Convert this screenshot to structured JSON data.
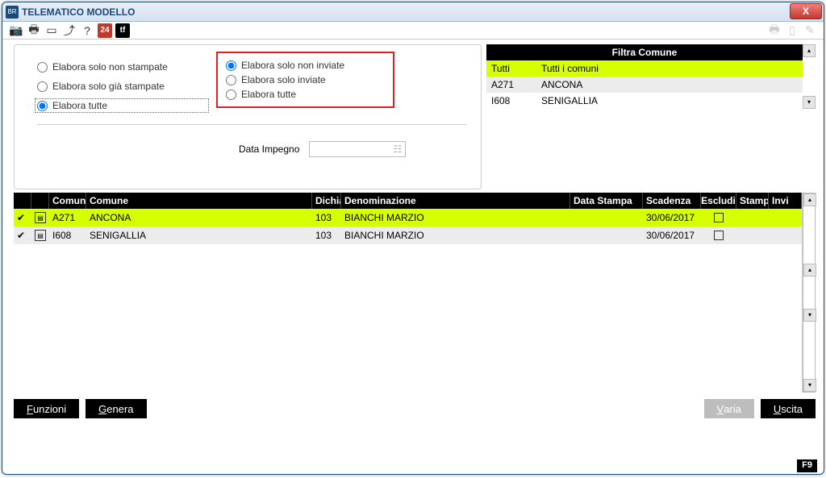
{
  "window": {
    "title": "TELEMATICO MODELLO",
    "icon_text": "BR"
  },
  "toolbar": {
    "camera": "camera-icon",
    "print": "print-icon",
    "open": "open-icon",
    "upload": "upload-icon",
    "help": "?",
    "red24": "24",
    "black": "tf"
  },
  "options": {
    "stampate": {
      "non_stampate": "Elabora solo non stampate",
      "gia_stampate": "Elabora solo già stampate",
      "tutte": "Elabora tutte"
    },
    "inviate": {
      "non_inviate": "Elabora solo non inviate",
      "solo_inviate": "Elabora solo inviate",
      "tutte": "Elabora tutte"
    },
    "data_impegno_label": "Data Impegno",
    "data_impegno_value": ""
  },
  "filtro": {
    "header": "Filtra Comune",
    "rows": [
      {
        "code": "Tutti",
        "name": "Tutti i comuni",
        "selected": true
      },
      {
        "code": "A271",
        "name": "ANCONA",
        "selected": false
      },
      {
        "code": "I608",
        "name": "SENIGALLIA",
        "selected": false
      }
    ]
  },
  "grid": {
    "headers": {
      "c3": "Comun",
      "c4": "Comune",
      "c5": "Dichia",
      "c6": "Denominazione",
      "c7": "Data Stampa",
      "c8": "Scadenza",
      "c9": "Escludi",
      "c10": "Stamp",
      "c11": "Invi"
    },
    "rows": [
      {
        "code": "A271",
        "comune": "ANCONA",
        "dich": "103",
        "denom": "BIANCHI MARZIO",
        "data_stampa": "",
        "scadenza": "30/06/2017",
        "escludi": false,
        "selected": true
      },
      {
        "code": "I608",
        "comune": "SENIGALLIA",
        "dich": "103",
        "denom": "BIANCHI MARZIO",
        "data_stampa": "",
        "scadenza": "30/06/2017",
        "escludi": false,
        "selected": false
      }
    ]
  },
  "buttons": {
    "funzioni": "Funzioni",
    "genera": "Genera",
    "varia": "Varia",
    "uscita": "Uscita"
  },
  "status": {
    "f9": "F9"
  }
}
